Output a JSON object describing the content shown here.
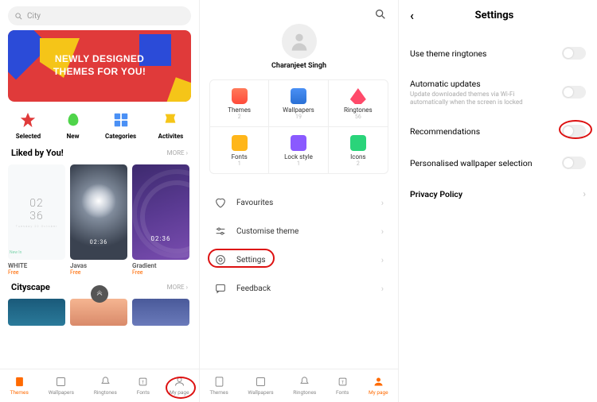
{
  "panel1": {
    "search_placeholder": "City",
    "banner_line1": "Newly Designed",
    "banner_line2": "Themes For You!",
    "cats": {
      "selected": "Selected",
      "new": "New",
      "categories": "Categories",
      "activites": "Activites"
    },
    "liked_title": "Liked by You!",
    "liked_more": "MORE",
    "themes": [
      {
        "name": "WHITE",
        "price": "Free",
        "clock": "02\n36",
        "date": "Tuesday 22 October"
      },
      {
        "name": "Javas",
        "price": "Free",
        "time": "02:36"
      },
      {
        "name": "Gradient",
        "price": "Free",
        "time": "02:36"
      }
    ],
    "cityscape_title": "Cityscape",
    "cityscape_more": "MORE"
  },
  "panel2": {
    "username": "Charanjeet Singh",
    "grid": [
      {
        "label": "Themes",
        "count": "2"
      },
      {
        "label": "Wallpapers",
        "count": "19"
      },
      {
        "label": "Ringtones",
        "count": "56"
      },
      {
        "label": "Fonts",
        "count": "1"
      },
      {
        "label": "Lock style",
        "count": "1"
      },
      {
        "label": "Icons",
        "count": "2"
      }
    ],
    "menu": {
      "fav": "Favourites",
      "custom": "Customise theme",
      "settings": "Settings",
      "feedback": "Feedback"
    }
  },
  "panel3": {
    "title": "Settings",
    "rows": {
      "r1": "Use theme ringtones",
      "r2": "Automatic updates",
      "r2_sub": "Update downloaded themes via Wi-Fi automatically when the screen is locked",
      "r3": "Recommendations",
      "r4": "Personalised wallpaper selection",
      "r5": "Privacy Policy"
    }
  },
  "tabs": {
    "themes": "Themes",
    "wallpapers": "Wallpapers",
    "ringtones": "Ringtones",
    "fonts": "Fonts",
    "mypage": "My page"
  }
}
